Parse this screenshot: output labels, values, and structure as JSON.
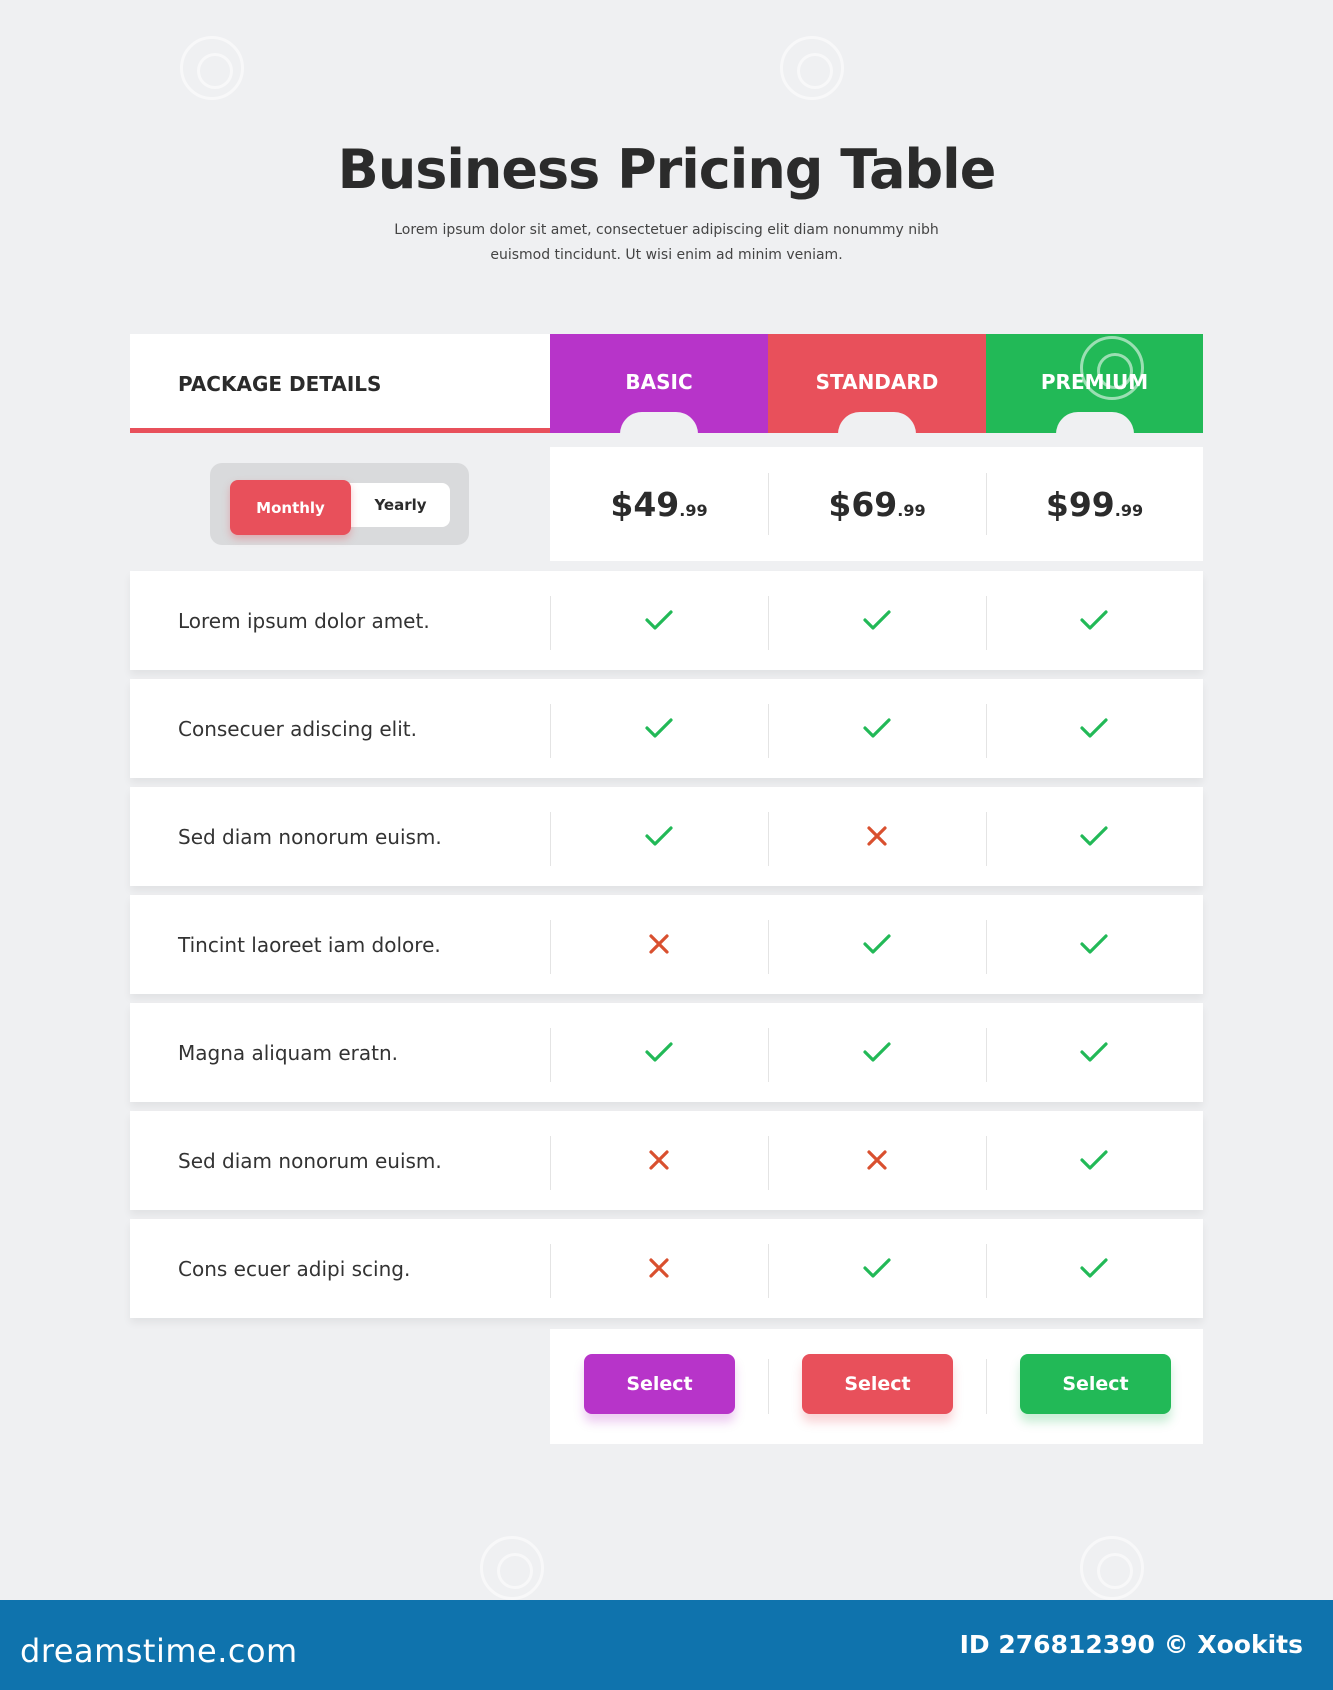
{
  "page": {
    "title": "Business Pricing Table",
    "subtitle_line1": "Lorem ipsum dolor sit amet, consectetuer adipiscing elit diam nonummy nibh",
    "subtitle_line2": "euismod tincidunt. Ut wisi enim ad minim veniam."
  },
  "table": {
    "package_details_label": "PACKAGE DETAILS",
    "billing_toggle": {
      "monthly_label": "Monthly",
      "yearly_label": "Yearly",
      "selected": "Monthly"
    },
    "plans": [
      {
        "name": "BASIC",
        "price_main": "$49",
        "price_cents": ".99",
        "color": "#b734c9",
        "select_label": "Select"
      },
      {
        "name": "STANDARD",
        "price_main": "$69",
        "price_cents": ".99",
        "color": "#e8505b",
        "select_label": "Select"
      },
      {
        "name": "PREMIUM",
        "price_main": "$99",
        "price_cents": ".99",
        "color": "#22b957",
        "select_label": "Select"
      }
    ],
    "features": [
      {
        "label": "Lorem ipsum dolor amet.",
        "included": [
          true,
          true,
          true
        ]
      },
      {
        "label": "Consecuer adiscing elit.",
        "included": [
          true,
          true,
          true
        ]
      },
      {
        "label": "Sed diam nonorum euism.",
        "included": [
          true,
          false,
          true
        ]
      },
      {
        "label": "Tincint laoreet iam dolore.",
        "included": [
          false,
          true,
          true
        ]
      },
      {
        "label": "Magna aliquam eratn.",
        "included": [
          true,
          true,
          true
        ]
      },
      {
        "label": "Sed diam nonorum euism.",
        "included": [
          false,
          false,
          true
        ]
      },
      {
        "label": "Cons ecuer adipi scing.",
        "included": [
          false,
          true,
          true
        ]
      }
    ],
    "icons": {
      "check": "check-icon",
      "cross": "cross-icon",
      "check_color": "#22b957",
      "cross_color": "#d9502f"
    }
  },
  "footer": {
    "logo_text": "dreamstime.com",
    "credit_text": "ID 276812390 © Xookits",
    "background": "#0f73ad"
  }
}
